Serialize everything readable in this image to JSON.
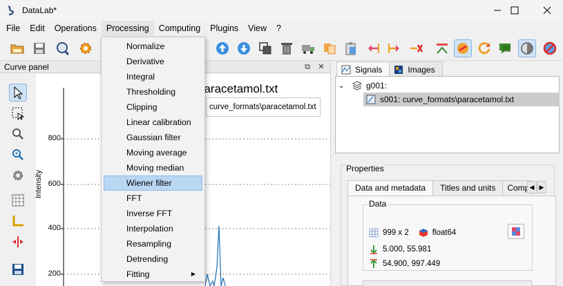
{
  "window": {
    "title": "DataLab*"
  },
  "menubar": [
    "File",
    "Edit",
    "Operations",
    "Processing",
    "Computing",
    "Plugins",
    "View",
    "?"
  ],
  "processing_menu": {
    "items": [
      {
        "label": "Normalize"
      },
      {
        "label": "Derivative"
      },
      {
        "label": "Integral"
      },
      {
        "label": "Thresholding"
      },
      {
        "label": "Clipping"
      },
      {
        "label": "Linear calibration"
      },
      {
        "label": "Gaussian filter"
      },
      {
        "label": "Moving average"
      },
      {
        "label": "Moving median"
      },
      {
        "label": "Wiener filter",
        "highlighted": true
      },
      {
        "label": "FFT"
      },
      {
        "label": "Inverse FFT"
      },
      {
        "label": "Interpolation"
      },
      {
        "label": "Resampling"
      },
      {
        "label": "Detrending"
      },
      {
        "label": "Fitting",
        "submenu": true
      }
    ]
  },
  "curve_panel": {
    "title": "Curve panel",
    "plot_title": "paracetamol.txt",
    "legend": "curve_formats\\paracetamol.txt",
    "ylabel": "Intensity",
    "yticks": [
      "800",
      "600",
      "400",
      "200"
    ]
  },
  "right_panel": {
    "tabs": [
      {
        "label": "Signals",
        "active": true
      },
      {
        "label": "Images",
        "active": false
      }
    ],
    "tree": {
      "group": "g001:",
      "signal": "s001: curve_formats\\paracetamol.txt"
    },
    "properties": {
      "title": "Properties",
      "tabs": [
        "Data and metadata",
        "Titles and units",
        "Compu"
      ],
      "data_group": {
        "title": "Data",
        "shape": "999 x 2",
        "dtype": "float64",
        "xmin_ymin": "5.000, 55.981",
        "xmax_ymax": "54.900, 997.449"
      }
    }
  },
  "colors": {
    "accent": "#0078d4",
    "highlight": "#b9d6f3",
    "curve": "#1f6fb5"
  }
}
